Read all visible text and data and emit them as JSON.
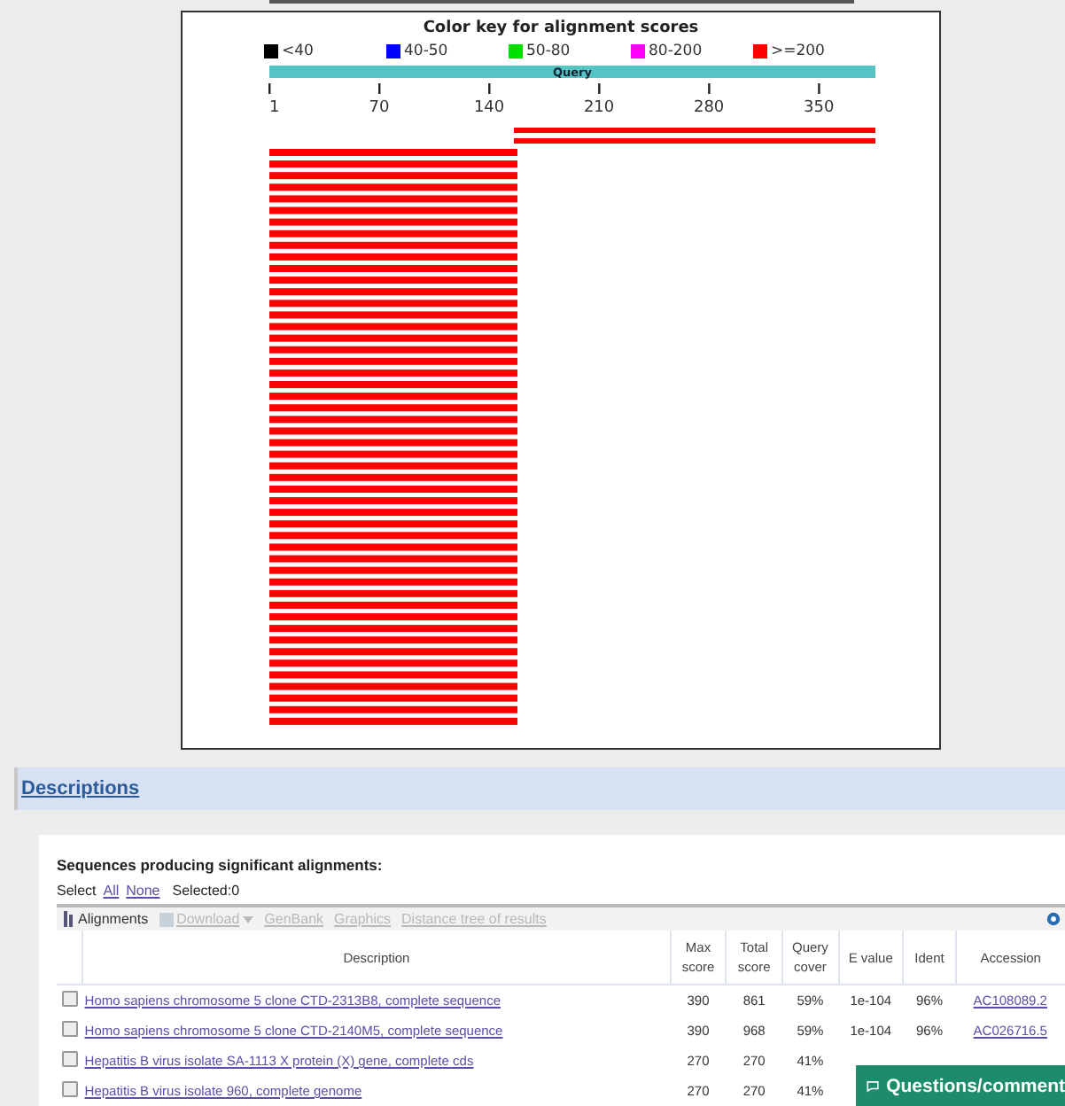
{
  "graphic": {
    "title": "Color key for alignment scores",
    "legend": [
      {
        "label": "<40",
        "color": "#000000"
      },
      {
        "label": "40-50",
        "color": "#0000ff"
      },
      {
        "label": "50-80",
        "color": "#00e000"
      },
      {
        "label": "80-200",
        "color": "#ff00ff"
      },
      {
        "label": ">=200",
        "color": "#ff0000"
      }
    ],
    "query_label": "Query",
    "ticks": [
      "1",
      "70",
      "140",
      "210",
      "280",
      "350"
    ]
  },
  "section": {
    "title": "Descriptions"
  },
  "results": {
    "heading": "Sequences producing significant alignments:",
    "select_label": "Select",
    "select_all": "All",
    "select_none": "None",
    "selected": "Selected:0",
    "toolbar": [
      {
        "label": "Alignments",
        "disabled": false
      },
      {
        "label": "Download",
        "disabled": true
      },
      {
        "label": "GenBank",
        "disabled": true
      },
      {
        "label": "Graphics",
        "disabled": true
      },
      {
        "label": "Distance tree of results",
        "disabled": true
      }
    ],
    "columns": [
      "Description",
      "Max score",
      "Total score",
      "Query cover",
      "E value",
      "Ident",
      "Accession"
    ],
    "rows": [
      {
        "checked": false,
        "cells": [
          "Homo sapiens chromosome 5 clone CTD-2313B8, complete sequence",
          "390",
          "861",
          "59%",
          "1e-104",
          "96%",
          "AC108089.2"
        ]
      },
      {
        "checked": false,
        "cells": [
          "Homo sapiens chromosome 5 clone CTD-2140M5, complete sequence",
          "390",
          "968",
          "59%",
          "1e-104",
          "96%",
          "AC026716.5"
        ]
      },
      {
        "checked": false,
        "cells": [
          "Hepatitis B virus isolate SA-1113 X protein (X) gene, complete cds",
          "270",
          "270",
          "41%"
        ]
      },
      {
        "checked": false,
        "cells": [
          "Hepatitis B virus isolate 960, complete genome",
          "270",
          "270",
          "41%"
        ]
      }
    ]
  },
  "feedback_button": "Questions/comment"
}
